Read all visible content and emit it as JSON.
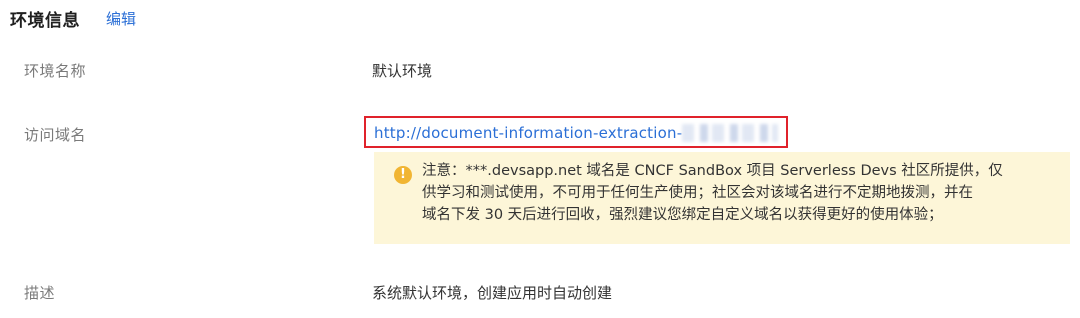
{
  "header": {
    "title": "环境信息",
    "edit_label": "编辑"
  },
  "fields": {
    "env_name": {
      "label": "环境名称",
      "value": "默认环境"
    },
    "domain": {
      "label": "访问域名",
      "url": "http://document-information-extraction-"
    },
    "description": {
      "label": "描述",
      "value": "系统默认环境，创建应用时自动创建"
    }
  },
  "notice": {
    "icon": "warning-icon",
    "lines": [
      "注意：***.devsapp.net 域名是 CNCF SandBox 项目 Serverless Devs 社区所提供，仅",
      "供学习和测试使用，不可用于任何生产使用；社区会对该域名进行不定期地拨测，并在",
      "域名下发 30 天后进行回收，强烈建议您绑定自定义域名以获得更好的使用体验；"
    ]
  },
  "colors": {
    "link": "#2b6fd6",
    "highlight_border": "#e0222b",
    "notice_bg": "#fdf6d8",
    "warning": "#f1b532"
  }
}
